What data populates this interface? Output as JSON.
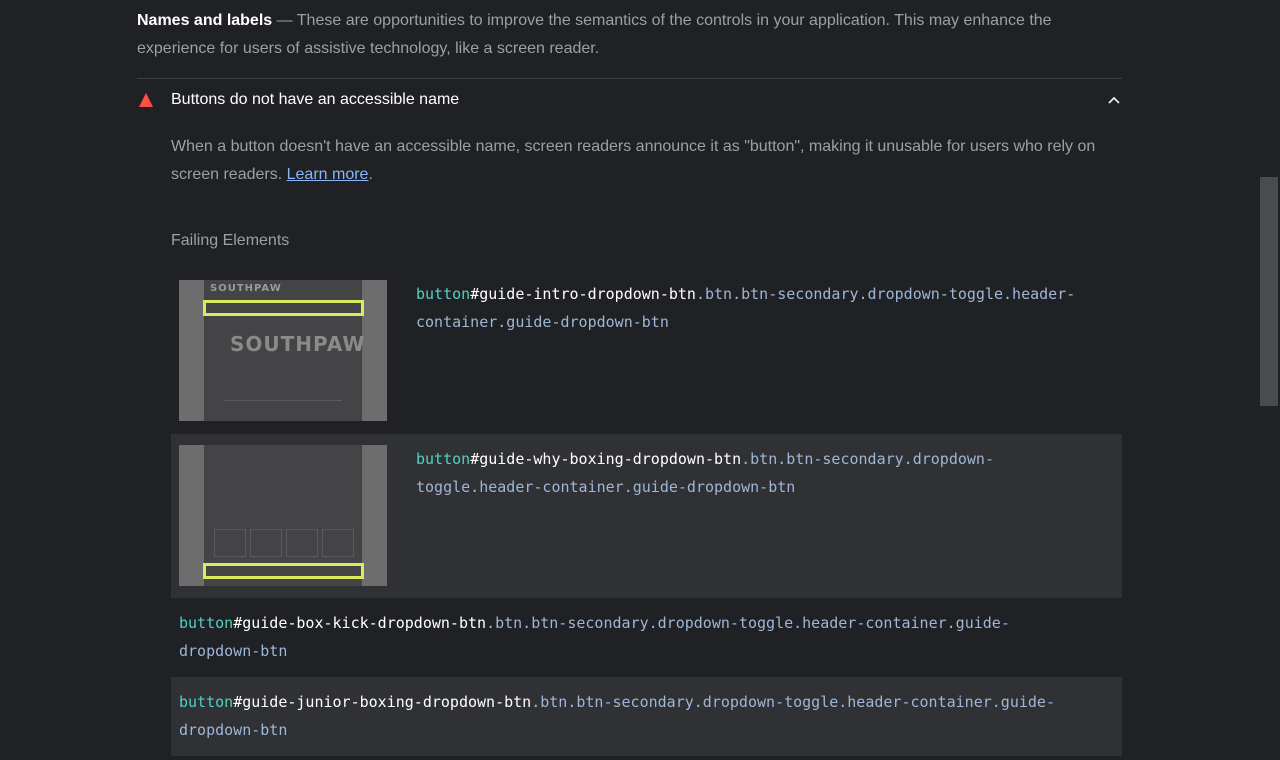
{
  "group": {
    "title": "Names and labels",
    "separator": "—",
    "description": "These are opportunities to improve the semantics of the controls in your application. This may enhance the experience for users of assistive technology, like a screen reader."
  },
  "audit": {
    "title": "Buttons do not have an accessible name",
    "description": "When a button doesn't have an accessible name, screen readers announce it as \"button\", making it unusable for users who rely on screen readers.",
    "learn_more": "Learn more",
    "period": ".",
    "failing_label": "Failing Elements",
    "status_color": "#ff4e42"
  },
  "elements": [
    {
      "tag": "button",
      "id": "#guide-intro-dropdown-btn",
      "classes": ".btn.btn-secondary.dropdown-toggle.header-container.guide-dropdown-btn",
      "thumbnail_text": "SOUTHPAW"
    },
    {
      "tag": "button",
      "id": "#guide-why-boxing-dropdown-btn",
      "classes": ".btn.btn-secondary.dropdown-toggle.header-container.guide-dropdown-btn"
    },
    {
      "tag": "button",
      "id": "#guide-box-kick-dropdown-btn",
      "classes": ".btn.btn-secondary.dropdown-toggle.header-container.guide-dropdown-btn"
    },
    {
      "tag": "button",
      "id": "#guide-junior-boxing-dropdown-btn",
      "classes": ".btn.btn-secondary.dropdown-toggle.header-container.guide-dropdown-btn"
    }
  ]
}
